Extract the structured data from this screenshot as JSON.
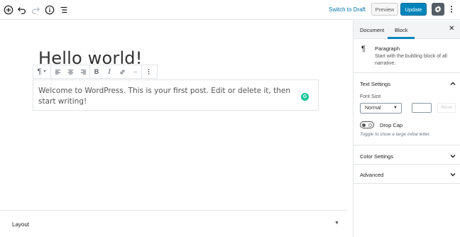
{
  "topbar": {
    "add_icon": "plus-circle-icon",
    "undo_icon": "undo-icon",
    "redo_icon": "redo-icon",
    "info_icon": "info-icon",
    "outline_icon": "list-view-icon",
    "switch_to_draft": "Switch to Draft",
    "preview": "Preview",
    "update": "Update",
    "settings_icon": "gear-icon",
    "more_icon": "more-vertical-icon"
  },
  "editor": {
    "title": "Hello world!",
    "paragraph": "Welcome to WordPress. This is your first post. Edit or delete it, then start writing!",
    "grammarly_badge": "G",
    "block_toolbar": {
      "items": [
        "paragraph-icon",
        "align-left-icon",
        "align-center-icon",
        "align-right-icon",
        "bold-icon",
        "italic-icon",
        "link-icon",
        "more-rich-text-icon",
        "more-options-icon"
      ],
      "bold": "B",
      "italic": "I",
      "more": "···"
    }
  },
  "layout_panel": {
    "label": "Layout"
  },
  "sidebar": {
    "tabs": [
      {
        "label": "Document",
        "active": false
      },
      {
        "label": "Block",
        "active": true
      }
    ],
    "close": "✕",
    "block_card": {
      "icon": "¶",
      "title": "Paragraph",
      "description": "Start with the building block of all narrative."
    },
    "text_settings": {
      "title": "Text Settings",
      "font_size_label": "Font Size",
      "font_size_value": "Normal",
      "reset_label": "Reset",
      "drop_cap_label": "Drop Cap",
      "drop_cap_help": "Toggle to show a large initial letter."
    },
    "color_settings": {
      "title": "Color Settings"
    },
    "advanced": {
      "title": "Advanced"
    }
  },
  "colors": {
    "accent": "#0085ba",
    "link": "#0073aa",
    "grammarly": "#15c39a"
  }
}
